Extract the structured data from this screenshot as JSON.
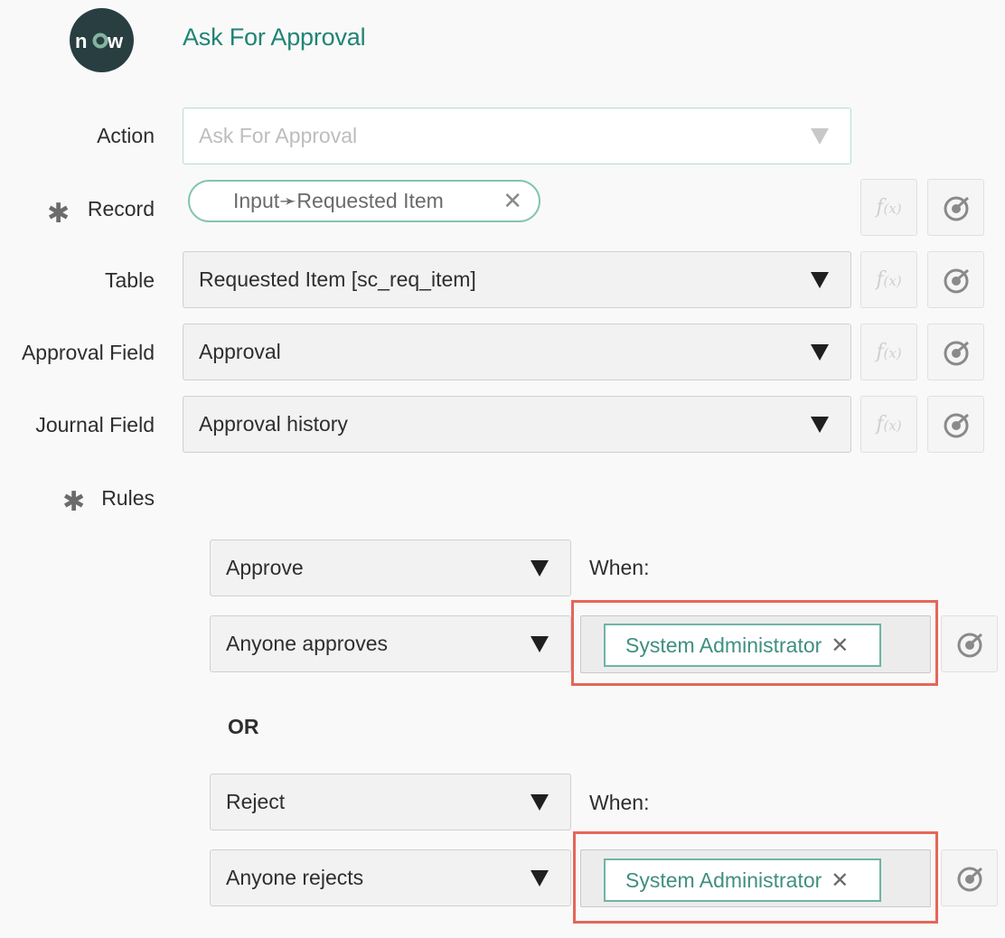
{
  "header": {
    "logo_text": "now",
    "title": "Ask For Approval"
  },
  "fields": {
    "action": {
      "label": "Action",
      "placeholder": "Ask For Approval"
    },
    "record": {
      "label": "Record",
      "required_mark": "✱",
      "value": "Input➛Requested Item",
      "remove": "✕"
    },
    "table": {
      "label": "Table",
      "value": "Requested Item [sc_req_item]"
    },
    "approval_field": {
      "label": "Approval Field",
      "value": "Approval"
    },
    "journal_field": {
      "label": "Journal Field",
      "value": "Approval history"
    }
  },
  "side_buttons": {
    "fx_main": "f",
    "fx_sub": "(x)",
    "pill_icon": "data-pill-icon"
  },
  "rules": {
    "label": "Rules",
    "required_mark": "✱",
    "when_label": "When:",
    "or_label": "OR",
    "items": [
      {
        "action": "Approve",
        "condition": "Anyone approves",
        "user": "System Administrator",
        "remove": "✕"
      },
      {
        "action": "Reject",
        "condition": "Anyone rejects",
        "user": "System Administrator",
        "remove": "✕"
      }
    ]
  },
  "colors": {
    "accent": "#1f8476",
    "highlight": "#e4675a",
    "logo_bg": "#293e40",
    "chip_border": "#6fb4a6"
  }
}
